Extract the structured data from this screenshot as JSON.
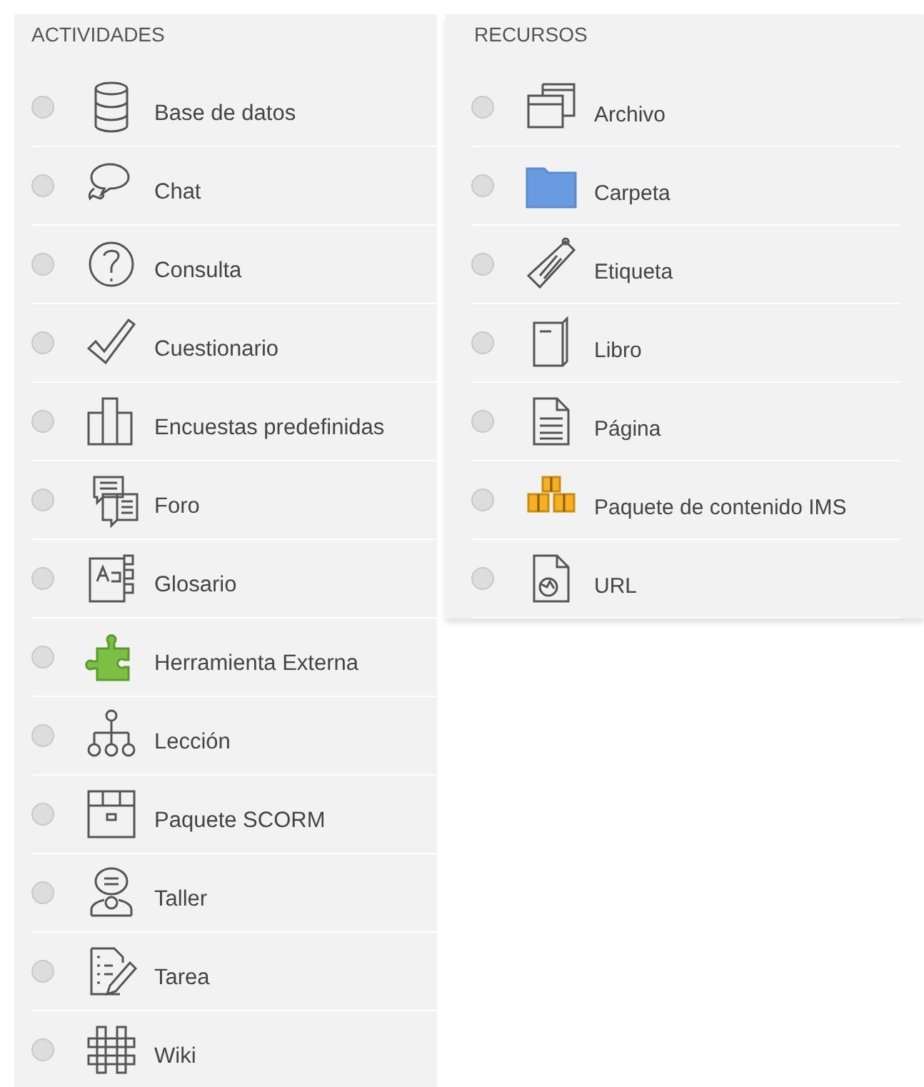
{
  "sections": [
    {
      "heading": "ACTIVIDADES",
      "items": [
        {
          "label": "Base de datos",
          "selected": false
        },
        {
          "label": "Chat",
          "selected": false
        },
        {
          "label": "Consulta",
          "selected": false
        },
        {
          "label": "Cuestionario",
          "selected": false
        },
        {
          "label": "Encuestas predefinidas",
          "selected": false
        },
        {
          "label": "Foro",
          "selected": false
        },
        {
          "label": "Glosario",
          "selected": false
        },
        {
          "label": "Herramienta Externa",
          "selected": false
        },
        {
          "label": "Lección",
          "selected": false
        },
        {
          "label": "Paquete SCORM",
          "selected": false
        },
        {
          "label": "Taller",
          "selected": false
        },
        {
          "label": "Tarea",
          "selected": false
        },
        {
          "label": "Wiki",
          "selected": false
        }
      ]
    },
    {
      "heading": "RECURSOS",
      "items": [
        {
          "label": "Archivo",
          "selected": false
        },
        {
          "label": "Carpeta",
          "selected": false
        },
        {
          "label": "Etiqueta",
          "selected": false
        },
        {
          "label": "Libro",
          "selected": false
        },
        {
          "label": "Página",
          "selected": false
        },
        {
          "label": "Paquete de contenido IMS",
          "selected": false
        },
        {
          "label": "URL",
          "selected": false
        }
      ]
    }
  ]
}
